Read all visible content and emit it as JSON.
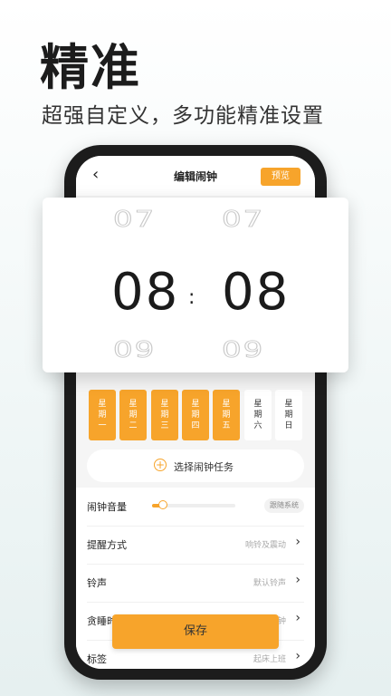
{
  "hero": {
    "title": "精准",
    "subtitle": "超强自定义，多功能精准设置"
  },
  "nav": {
    "back_icon": "chevron-left-icon",
    "title": "编辑闹钟",
    "preview_label": "预览"
  },
  "time_picker": {
    "hour_prev": "07",
    "hour": "08",
    "hour_next": "09",
    "minute_prev": "07",
    "minute": "08",
    "minute_next": "09",
    "separator": ":"
  },
  "weekdays": [
    {
      "label": "星期一",
      "selected": true
    },
    {
      "label": "星期二",
      "selected": true
    },
    {
      "label": "星期三",
      "selected": true
    },
    {
      "label": "星期四",
      "selected": true
    },
    {
      "label": "星期五",
      "selected": true
    },
    {
      "label": "星期六",
      "selected": false
    },
    {
      "label": "星期日",
      "selected": false
    }
  ],
  "task": {
    "icon": "plus-circle-icon",
    "label": "选择闹钟任务"
  },
  "settings": {
    "volume": {
      "label": "闹钟音量",
      "level_fraction": 0.13,
      "chip": "跟随系统"
    },
    "reminder": {
      "label": "提醒方式",
      "value": "响铃及震动"
    },
    "ringtone": {
      "label": "铃声",
      "value": "默认铃声"
    },
    "snooze": {
      "label": "贪睡时间",
      "value": "5分钟"
    },
    "tag": {
      "label": "标签",
      "value": "起床上班"
    }
  },
  "save_label": "保存",
  "colors": {
    "accent": "#f7a42b"
  }
}
